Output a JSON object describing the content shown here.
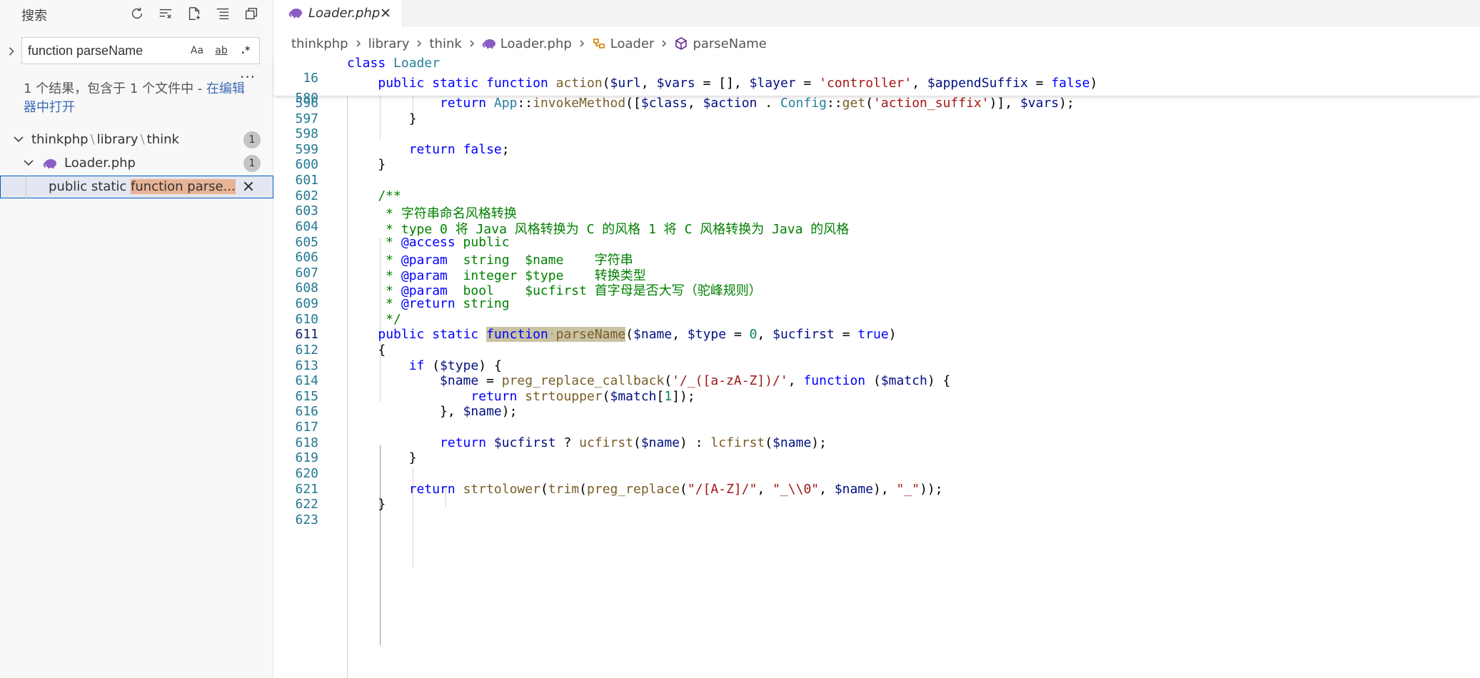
{
  "sidebar": {
    "title": "搜索",
    "actions": [
      "refresh-icon",
      "clear-results-icon",
      "new-search-editor-icon",
      "collapse-all-icon",
      "view-as-tree-icon"
    ],
    "search": {
      "query": "function parseName",
      "match_case": "Aa",
      "whole_word": "ab",
      "regex": ".*"
    },
    "more": "...",
    "result_message": "1 个结果，包含于 1 个文件中 - ",
    "open_in_editor": "在编辑器中打开",
    "tree": {
      "folder": {
        "path_parts": [
          "thinkphp",
          "library",
          "think"
        ],
        "count": "1"
      },
      "file": {
        "name": "Loader.php",
        "count": "1"
      },
      "match": {
        "before": "public static ",
        "highlight": "function parse..."
      }
    }
  },
  "editor": {
    "tab": {
      "label": "Loader.php"
    },
    "breadcrumbs": [
      "thinkphp",
      "library",
      "think",
      "Loader.php",
      "Loader",
      "parseName"
    ],
    "sticky": [
      {
        "ln": "16",
        "text": "class Loader"
      },
      {
        "ln": "580",
        "text": "    public static function action($url, $vars = [], $layer = 'controller', $appendSuffix = false)"
      }
    ],
    "first_hidden_ln": "595",
    "active_line": "611",
    "lines": [
      {
        "ln": "596",
        "text": "            return App::invokeMethod([$class, $action . Config::get('action_suffix')], $vars);"
      },
      {
        "ln": "597",
        "text": "        }"
      },
      {
        "ln": "598",
        "text": ""
      },
      {
        "ln": "599",
        "text": "        return false;"
      },
      {
        "ln": "600",
        "text": "    }"
      },
      {
        "ln": "601",
        "text": ""
      },
      {
        "ln": "602",
        "text": "    /**"
      },
      {
        "ln": "603",
        "text": "     * 字符串命名风格转换"
      },
      {
        "ln": "604",
        "text": "     * type 0 将 Java 风格转换为 C 的风格 1 将 C 风格转换为 Java 的风格"
      },
      {
        "ln": "605",
        "text": "     * @access public"
      },
      {
        "ln": "606",
        "text": "     * @param  string  $name    字符串"
      },
      {
        "ln": "607",
        "text": "     * @param  integer $type    转换类型"
      },
      {
        "ln": "608",
        "text": "     * @param  bool    $ucfirst 首字母是否大写（驼峰规则）"
      },
      {
        "ln": "609",
        "text": "     * @return string"
      },
      {
        "ln": "610",
        "text": "     */"
      },
      {
        "ln": "611",
        "text": "    public static function parseName($name, $type = 0, $ucfirst = true)"
      },
      {
        "ln": "612",
        "text": "    {"
      },
      {
        "ln": "613",
        "text": "        if ($type) {"
      },
      {
        "ln": "614",
        "text": "            $name = preg_replace_callback('/_([a-zA-Z])/', function ($match) {"
      },
      {
        "ln": "615",
        "text": "                return strtoupper($match[1]);"
      },
      {
        "ln": "616",
        "text": "            }, $name);"
      },
      {
        "ln": "617",
        "text": ""
      },
      {
        "ln": "618",
        "text": "            return $ucfirst ? ucfirst($name) : lcfirst($name);"
      },
      {
        "ln": "619",
        "text": "        }"
      },
      {
        "ln": "620",
        "text": ""
      },
      {
        "ln": "621",
        "text": "        return strtolower(trim(preg_replace(\"/[A-Z]/\", \"_\\\\0\", $name), \"_\"));"
      },
      {
        "ln": "622",
        "text": "    }"
      },
      {
        "ln": "623",
        "text": ""
      }
    ]
  },
  "colors": {
    "accent": "#0060c0",
    "match_highlight": "#e9b395",
    "keyword": "#0000ff",
    "string": "#a31515",
    "variable": "#001080",
    "comment": "#008000",
    "function": "#795e26",
    "class": "#267f99",
    "line_number": "#237893"
  }
}
